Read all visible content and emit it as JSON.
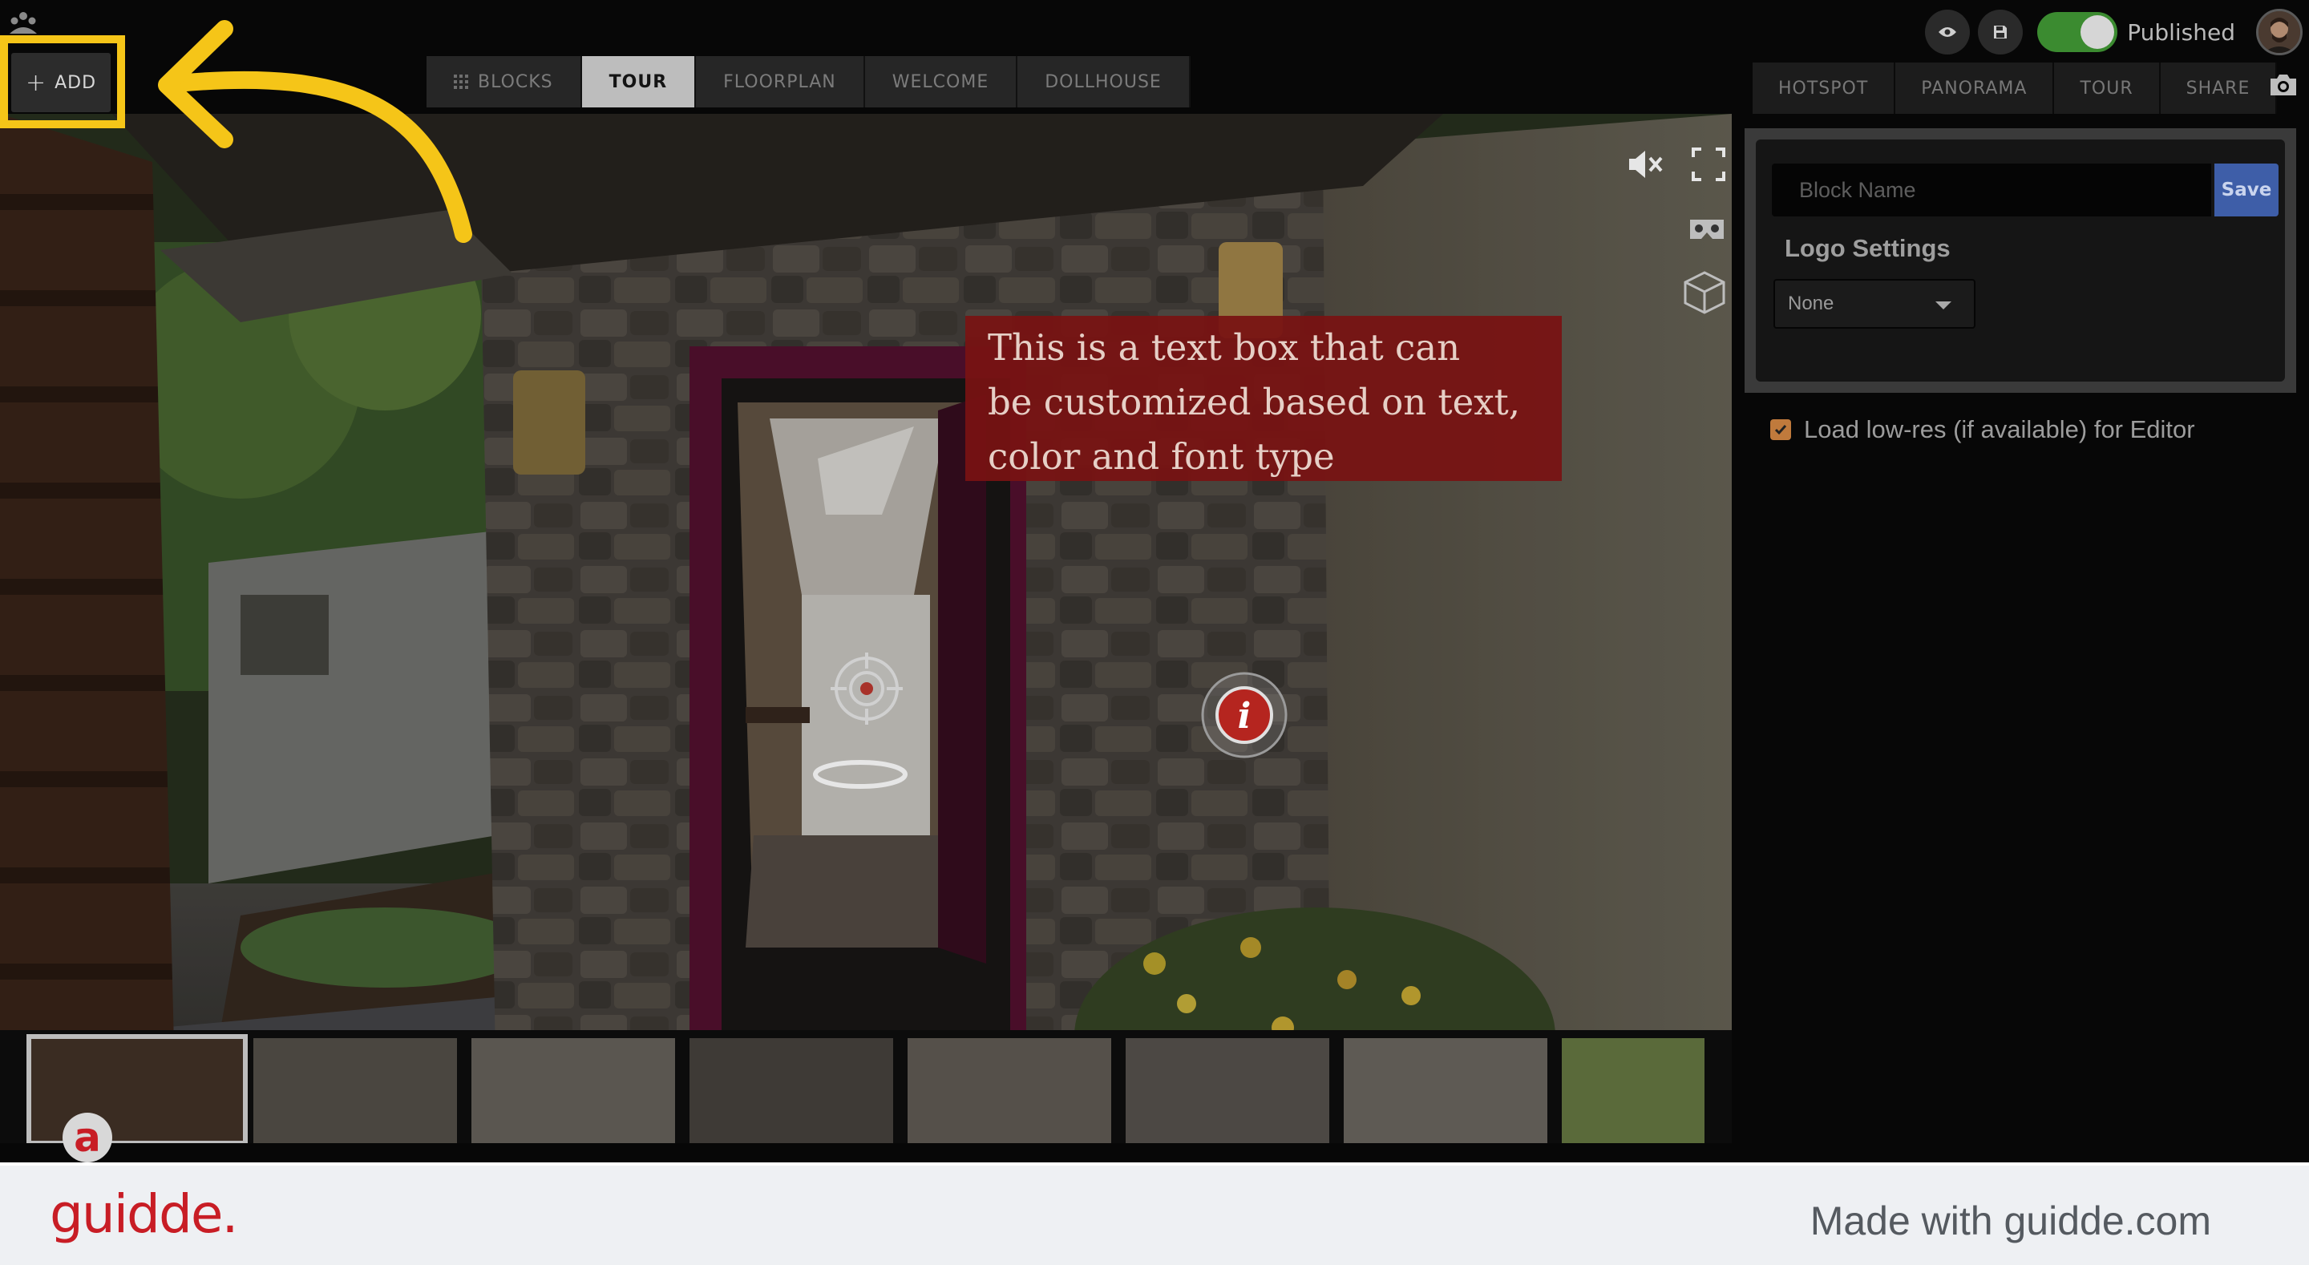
{
  "toolbar": {
    "add_label": "ADD"
  },
  "mode_tabs": [
    {
      "label": "BLOCKS"
    },
    {
      "label": "TOUR"
    },
    {
      "label": "FLOORPLAN"
    },
    {
      "label": "WELCOME"
    },
    {
      "label": "DOLLHOUSE"
    }
  ],
  "active_mode_tab": "TOUR",
  "status": {
    "published_label": "Published",
    "published": true
  },
  "panel_tabs": [
    {
      "label": "HOTSPOT"
    },
    {
      "label": "PANORAMA"
    },
    {
      "label": "TOUR"
    },
    {
      "label": "SHARE"
    }
  ],
  "viewer": {
    "text_box": "This is a text box that can\nbe customized based on text,\ncolor and font type"
  },
  "side_panel": {
    "block_name_placeholder": "Block Name",
    "save_label": "Save",
    "logo_settings_title": "Logo Settings",
    "logo_select_value": "None",
    "lowres_label": "Load low-res (if available) for Editor",
    "lowres_checked": true
  },
  "footer": {
    "brand": "guidde.",
    "tagline": "Made with guidde.com",
    "badge": "a"
  },
  "colors": {
    "highlight": "#f5c518",
    "text_box_bg": "#781212",
    "save_button": "#3e5ea8",
    "toggle_on": "#3b8b30",
    "brand_red": "#c81d25"
  },
  "icons": [
    "app-logo-icon",
    "plus-icon",
    "grid-icon",
    "eye-icon",
    "save-icon",
    "mute-icon",
    "fullscreen-icon",
    "vr-headset-icon",
    "cube-icon",
    "target-hotspot-icon",
    "info-icon",
    "camera-icon",
    "checkmark-icon",
    "caret-down-icon"
  ]
}
